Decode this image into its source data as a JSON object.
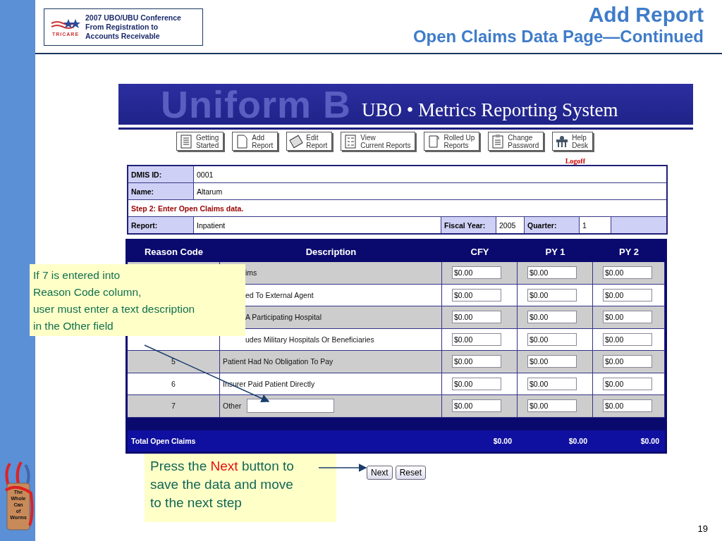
{
  "header": {
    "logo_lines": [
      "2007 UBO/UBU Conference",
      "From Registration to",
      "Accounts Receivable"
    ],
    "logo_caption": "TRICARE",
    "title": "Add Report",
    "subtitle": "Open Claims Data Page—Continued"
  },
  "app": {
    "banner": {
      "backdrop_text": "Uniform B",
      "title": "UBO • Metrics Reporting System"
    },
    "nav": [
      {
        "lines": [
          "Getting",
          "Started"
        ]
      },
      {
        "lines": [
          "Add",
          "Report"
        ]
      },
      {
        "lines": [
          "Edit",
          "Report"
        ]
      },
      {
        "lines": [
          "View",
          "Current Reports"
        ]
      },
      {
        "lines": [
          "Rolled Up",
          "Reports"
        ]
      },
      {
        "lines": [
          "Change",
          "Password"
        ]
      },
      {
        "lines": [
          "Help",
          "Desk"
        ]
      }
    ],
    "logoff": "Logoff",
    "info": {
      "dmis_label": "DMIS ID:",
      "dmis_value": "0001",
      "name_label": "Name:",
      "name_value": "Altarum",
      "step": "Step 2: Enter Open Claims data.",
      "report_label": "Report:",
      "report_value": "Inpatient",
      "fiscal_year_label": "Fiscal Year:",
      "fiscal_year_value": "2005",
      "quarter_label": "Quarter:",
      "quarter_value": "1"
    },
    "table": {
      "columns": [
        "Reason Code",
        "Description",
        "CFY",
        "PY 1",
        "PY 2"
      ],
      "rows": [
        {
          "kind": "text",
          "code": "",
          "description": "ims",
          "cfy": "$0.00",
          "py1": "$0.00",
          "py2": "$0.00"
        },
        {
          "kind": "text",
          "code": "",
          "description": "ed To External Agent",
          "cfy": "$0.00",
          "py1": "$0.00",
          "py2": "$0.00"
        },
        {
          "kind": "text",
          "code": "",
          "description": "A Participating Hospital",
          "cfy": "$0.00",
          "py1": "$0.00",
          "py2": "$0.00"
        },
        {
          "kind": "text",
          "code": "",
          "description": "udes Military Hospitals Or Beneficiaries",
          "cfy": "$0.00",
          "py1": "$0.00",
          "py2": "$0.00"
        },
        {
          "kind": "text",
          "code": "5",
          "description": "Patient Had No Obligation To Pay",
          "cfy": "$0.00",
          "py1": "$0.00",
          "py2": "$0.00"
        },
        {
          "kind": "text",
          "code": "6",
          "description": "Insurer Paid Patient Directly",
          "cfy": "$0.00",
          "py1": "$0.00",
          "py2": "$0.00"
        },
        {
          "kind": "other",
          "code": "7",
          "description": "Other",
          "cfy": "$0.00",
          "py1": "$0.00",
          "py2": "$0.00"
        }
      ],
      "total": {
        "label": "Total Open Claims",
        "cfy": "$0.00",
        "py1": "$0.00",
        "py2": "$0.00"
      }
    },
    "buttons": [
      "Next",
      "Reset"
    ]
  },
  "callouts": [
    {
      "lines": [
        "If 7 is entered into",
        "Reason Code column,",
        "user must enter a text description",
        "in the Other field"
      ]
    },
    {
      "lines": [
        "Press the **Next** button to",
        "save the data and move",
        "to the next step"
      ]
    }
  ],
  "can_text": [
    "The",
    "Whole",
    "Can",
    "of",
    "Worms"
  ],
  "page_number": "19"
}
